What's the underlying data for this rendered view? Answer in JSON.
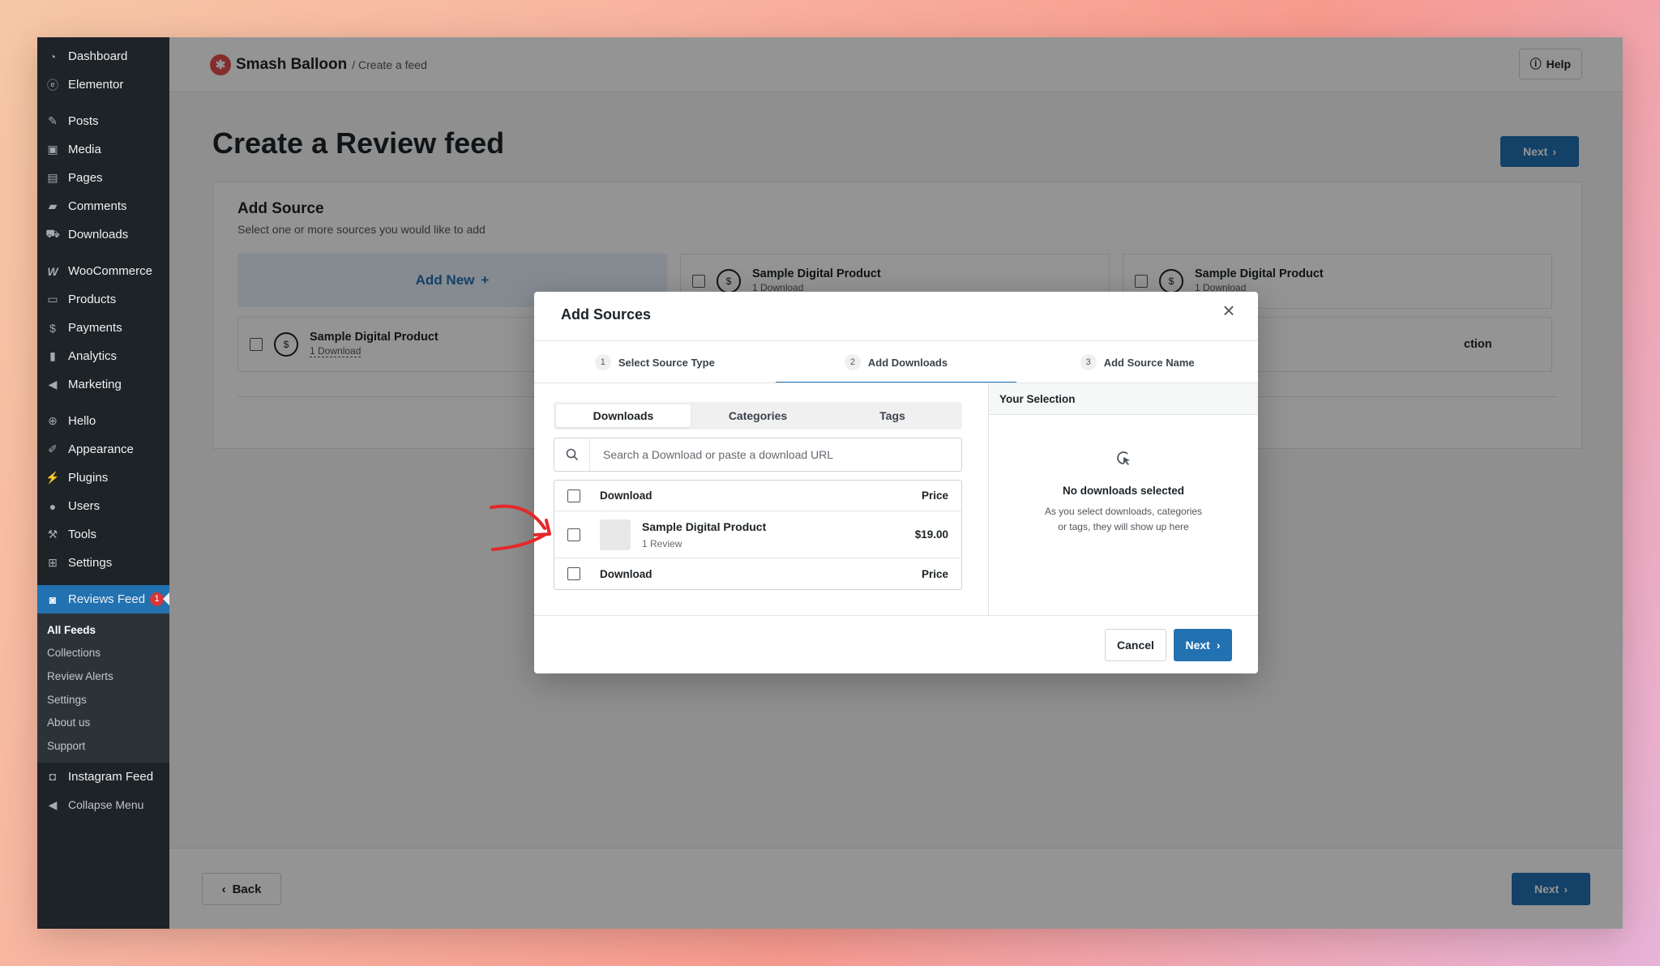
{
  "sidebar": {
    "items": [
      {
        "label": "Dashboard",
        "icon": "dashboard-icon"
      },
      {
        "label": "Elementor",
        "icon": "elementor-icon"
      },
      {
        "label": "Posts",
        "icon": "pin-icon"
      },
      {
        "label": "Media",
        "icon": "media-icon"
      },
      {
        "label": "Pages",
        "icon": "pages-icon"
      },
      {
        "label": "Comments",
        "icon": "comments-icon"
      },
      {
        "label": "Downloads",
        "icon": "cart-icon"
      },
      {
        "label": "WooCommerce",
        "icon": "woo-icon"
      },
      {
        "label": "Products",
        "icon": "archive-icon"
      },
      {
        "label": "Payments",
        "icon": "dollar-icon"
      },
      {
        "label": "Analytics",
        "icon": "bar-chart-icon"
      },
      {
        "label": "Marketing",
        "icon": "megaphone-icon"
      },
      {
        "label": "Hello",
        "icon": "plus-circle-icon"
      },
      {
        "label": "Appearance",
        "icon": "brush-icon"
      },
      {
        "label": "Plugins",
        "icon": "plug-icon"
      },
      {
        "label": "Users",
        "icon": "user-icon"
      },
      {
        "label": "Tools",
        "icon": "wrench-icon"
      },
      {
        "label": "Settings",
        "icon": "settings-icon"
      }
    ],
    "active": {
      "label": "Reviews Feed",
      "badge": "1",
      "icon": "reviews-icon"
    },
    "submenu": [
      "All Feeds",
      "Collections",
      "Review Alerts",
      "Settings",
      "About us",
      "Support"
    ],
    "after": [
      {
        "label": "Instagram Feed",
        "icon": "camera-icon"
      },
      {
        "label": "Collapse Menu",
        "icon": "collapse-icon"
      }
    ]
  },
  "topbar": {
    "brand": "Smash Balloon",
    "crumb": "/ Create a feed",
    "help": "Help"
  },
  "page": {
    "title": "Create a Review feed",
    "next": "Next",
    "card_title": "Add Source",
    "card_sub": "Select one or more sources you would like to add",
    "add_new": "Add New",
    "sources": [
      {
        "name": "Sample Digital Product",
        "meta": "1 Download"
      },
      {
        "name": "Sample Digital Product",
        "meta": "1 Download"
      },
      {
        "name": "Sample Digital Product",
        "meta": "1 Download"
      }
    ],
    "tile_partial": "ction",
    "back": "Back",
    "next_bottom": "Next"
  },
  "modal": {
    "title": "Add Sources",
    "steps": [
      {
        "num": "1",
        "label": "Select Source Type"
      },
      {
        "num": "2",
        "label": "Add Downloads"
      },
      {
        "num": "3",
        "label": "Add Source Name"
      }
    ],
    "tabs": [
      "Downloads",
      "Categories",
      "Tags"
    ],
    "search_placeholder": "Search a Download or paste a download URL",
    "table_head": {
      "col1": "Download",
      "col2": "Price"
    },
    "row": {
      "name": "Sample Digital Product",
      "sub": "1 Review",
      "price": "$19.00"
    },
    "table_foot": {
      "col1": "Download",
      "col2": "Price"
    },
    "selection_title": "Your Selection",
    "empty_title": "No downloads selected",
    "empty_desc": "As you select downloads, categories or tags, they will show up here",
    "cancel": "Cancel",
    "next": "Next"
  },
  "colors": {
    "accent": "#2271b1",
    "sidebar": "#1d2327",
    "badge": "#d63638",
    "annotation": "#e5282a"
  }
}
